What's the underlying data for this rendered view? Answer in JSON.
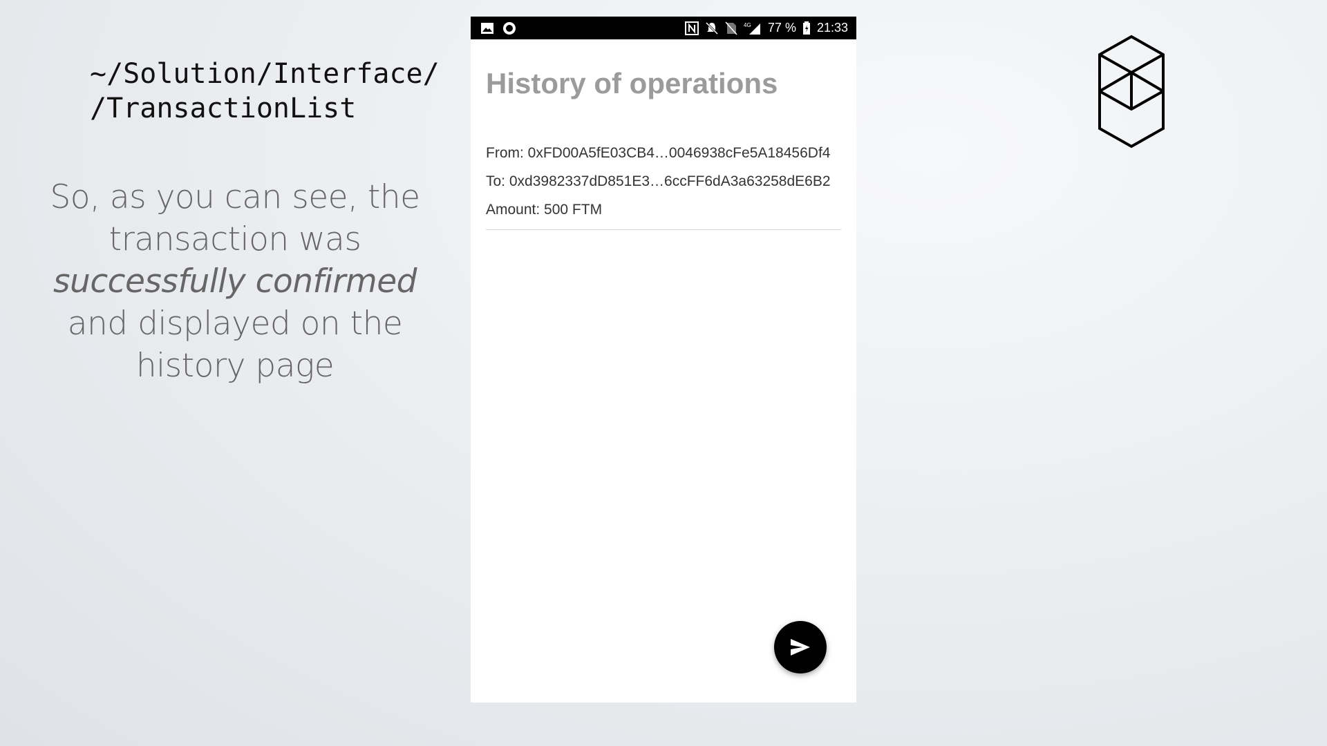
{
  "slide": {
    "path_line1": "~/Solution/Interface/",
    "path_line2": "/TransactionList",
    "caption_part1": "So, as you can see, the transaction was ",
    "caption_em1": "successfully confirmed",
    "caption_part2": " and displayed on the history page"
  },
  "phone": {
    "status_bar": {
      "battery": "77 %",
      "time": "21:33",
      "left_icons": [
        "image-icon",
        "record-icon"
      ],
      "right_icons": [
        "nfc-icon",
        "mute-icon",
        "no-sim-icon",
        "signal-4g-icon",
        "battery-icon"
      ]
    },
    "title": "History of operations",
    "transactions": [
      {
        "from": "From: 0xFD00A5fE03CB4…0046938cFe5A18456Df4",
        "to": "To: 0xd3982337dD851E3…6ccFF6dA3a63258dE6B2",
        "amount": "Amount: 500 FTM"
      }
    ],
    "fab_icon": "send-icon"
  },
  "colors": {
    "title": "#9b9b9b",
    "status_bar": "#000000",
    "fab": "#000000"
  }
}
